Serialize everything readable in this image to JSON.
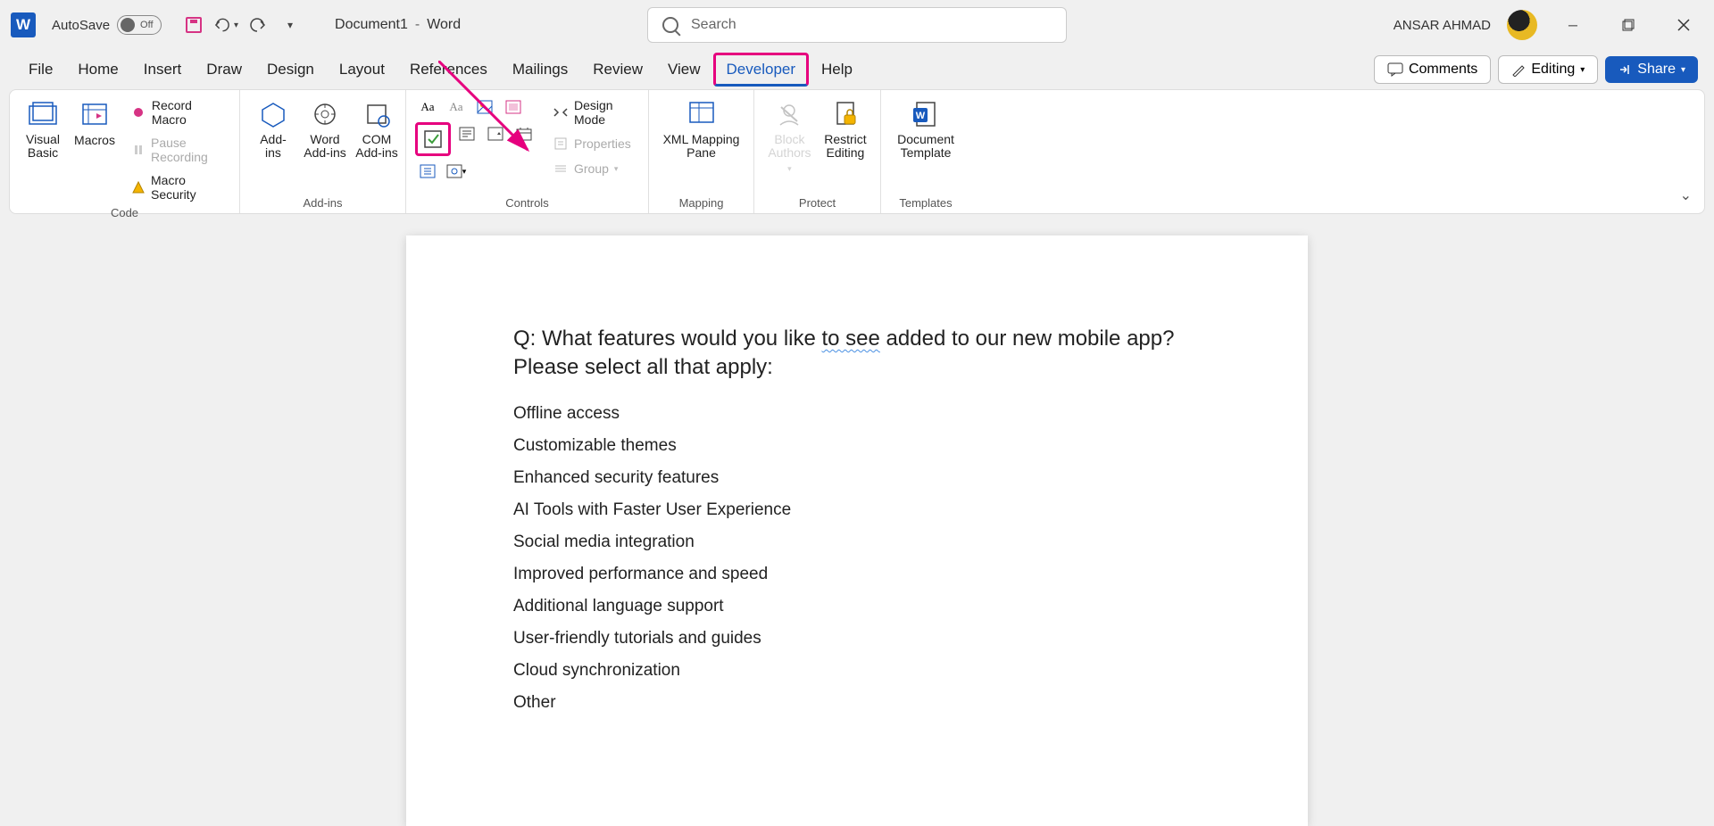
{
  "titlebar": {
    "autosave_label": "AutoSave",
    "autosave_state": "Off",
    "doc_name": "Document1",
    "app_name": "Word",
    "search_placeholder": "Search",
    "username": "ANSAR AHMAD"
  },
  "tabs": {
    "items": [
      "File",
      "Home",
      "Insert",
      "Draw",
      "Design",
      "Layout",
      "References",
      "Mailings",
      "Review",
      "View",
      "Developer",
      "Help"
    ],
    "active": "Developer",
    "comments": "Comments",
    "editing": "Editing",
    "share": "Share"
  },
  "ribbon": {
    "code": {
      "visual_basic": "Visual\nBasic",
      "macros": "Macros",
      "record_macro": "Record Macro",
      "pause_recording": "Pause Recording",
      "macro_security": "Macro Security",
      "label": "Code"
    },
    "addins": {
      "addins": "Add-\nins",
      "word_addins": "Word\nAdd-ins",
      "com_addins": "COM\nAdd-ins",
      "label": "Add-ins"
    },
    "controls": {
      "design_mode": "Design Mode",
      "properties": "Properties",
      "group": "Group",
      "label": "Controls"
    },
    "mapping": {
      "xml_mapping": "XML Mapping\nPane",
      "label": "Mapping"
    },
    "protect": {
      "block_authors": "Block\nAuthors",
      "restrict_editing": "Restrict\nEditing",
      "label": "Protect"
    },
    "templates": {
      "document_template": "Document\nTemplate",
      "label": "Templates"
    }
  },
  "document": {
    "question_prefix": "Q: What features would you like ",
    "question_squiggle": "to see",
    "question_suffix": " added to our new mobile app? Please select all that apply:",
    "options": [
      "Offline access",
      "Customizable themes",
      "Enhanced security features",
      "AI Tools with Faster User Experience",
      "Social media integration",
      "Improved performance and speed",
      "Additional language support",
      "User-friendly tutorials and guides",
      "Cloud synchronization",
      "Other"
    ]
  }
}
